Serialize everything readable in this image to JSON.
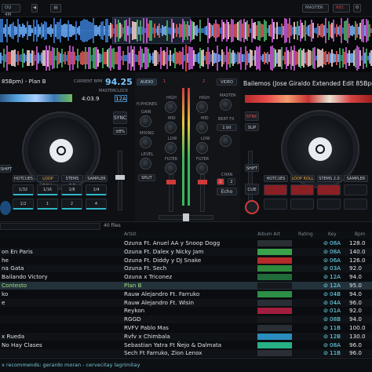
{
  "top": {
    "pill_left": "OU 4M",
    "master_label": "MASTER",
    "rec_label": "REC"
  },
  "deck_left": {
    "title": "85Bpm) - Plan B",
    "bpm": "94.25",
    "bpm_caption": "CURRENT BPM",
    "master_clock": "MASTERCLOCK",
    "key": "12A",
    "time": "4:03.9",
    "hotcues": [
      "HOTCUES",
      "LOOP ROLL",
      "STEMS 2.0",
      "SAMPLER"
    ],
    "pads_top": [
      "1/32",
      "1/16",
      "1/8",
      "1/4"
    ],
    "pads_bottom": [
      "1/2",
      "1",
      "2",
      "4"
    ],
    "sync": "SYNC",
    "shift": "SHIFT"
  },
  "mixer": {
    "audio": "AUDIO",
    "video": "VIDEO",
    "headphones": "H.PHONES",
    "gain": "GAIN",
    "mixing": "MIXING",
    "level": "LEVEL",
    "split": "SPLIT",
    "master": "MASTER",
    "beat_fx": "BEAT FX",
    "fx_value": "1 bit",
    "echo": "Echo",
    "high": "HIGH",
    "mid": "MID",
    "low": "LOW",
    "filter": "FILTER",
    "chan": "CHAN",
    "fx_left": "1",
    "fx_right": "2"
  },
  "deck_right": {
    "title": "Bailemos (Jose Giraldo Extended Edit 85Bpm)",
    "sync": "SYNC",
    "slip": "SLIP",
    "shift": "SHIFT",
    "cue": "CUE",
    "hotcues": [
      "HOTCUES",
      "LOOP ROLL",
      "STEMS 2.0",
      "SAMPLER"
    ]
  },
  "search": {
    "files_count": "40 files"
  },
  "library": {
    "headers": {
      "artist": "Artist",
      "album_art": "Album Art",
      "rating": "Rating",
      "key": "Key",
      "bpm": "Bpm"
    },
    "rows": [
      {
        "title": "",
        "artist": "Ozuna Ft. Anuel AA y Snoop Dogg",
        "key": "08A",
        "bpm": "128.0",
        "art": "#2a2f36"
      },
      {
        "title": "on En Paris",
        "artist": "Ozuna Ft. Dalex y Nicky Jam",
        "key": "08A",
        "bpm": "140.0",
        "art": "#3aa24a"
      },
      {
        "title": "he",
        "artist": "Ozuna Ft. Diddy y DJ Snake",
        "key": "06A",
        "bpm": "126.0",
        "art": "#b52a2a"
      },
      {
        "title": "na Gata",
        "artist": "Ozuna Ft. Sech",
        "key": "03A",
        "bpm": "92.0",
        "art": "#2e8a3c"
      },
      {
        "title": "Bailando Victory",
        "artist": "Ozuna x Triconez",
        "key": "12A",
        "bpm": "94.0",
        "art": "#1f6b3a"
      },
      {
        "title": "Contesto",
        "artist": "Plan B",
        "key": "12A",
        "bpm": "95.0",
        "art": "#15181d"
      },
      {
        "title": "ko",
        "artist": "Rauw Alejandro Ft. Farruko",
        "key": "04B",
        "bpm": "94.0",
        "art": "#2c8f46"
      },
      {
        "title": "e",
        "artist": "Rauw Alejandro Ft. Wisin",
        "key": "04A",
        "bpm": "96.0",
        "art": "#2a2f36"
      },
      {
        "title": "",
        "artist": "Reykon",
        "key": "01A",
        "bpm": "92.0",
        "art": "#a21e3e"
      },
      {
        "title": "",
        "artist": "RGGD",
        "key": "08B",
        "bpm": "94.0",
        "art": "#17191d"
      },
      {
        "title": "",
        "artist": "RVFV    Pablo Mas",
        "key": "11B",
        "bpm": "100.0",
        "art": "#2a2f36"
      },
      {
        "title": "x Rueda",
        "artist": "Rvfv x Chimbala",
        "key": "12B",
        "bpm": "130.0",
        "art": "#2a8dbf"
      },
      {
        "title": "No Hay Clases",
        "artist": "Sebastian Yatra Ft Ñejo & Dalmata",
        "key": "08A",
        "bpm": "96.0",
        "art": "#27b085"
      },
      {
        "title": "",
        "artist": "Sech Ft Farruko, Zion    Lenox",
        "key": "11B",
        "bpm": "96.0",
        "art": "#2a2f36"
      }
    ],
    "footer": "x recommends: gerardo moran - cervecitay lagrimitay"
  },
  "colors": {
    "accent_blue": "#79c7ff",
    "red": "#d23a3a",
    "cyan_key": "#6ee1f7",
    "selected_green": "#9ee37a"
  }
}
